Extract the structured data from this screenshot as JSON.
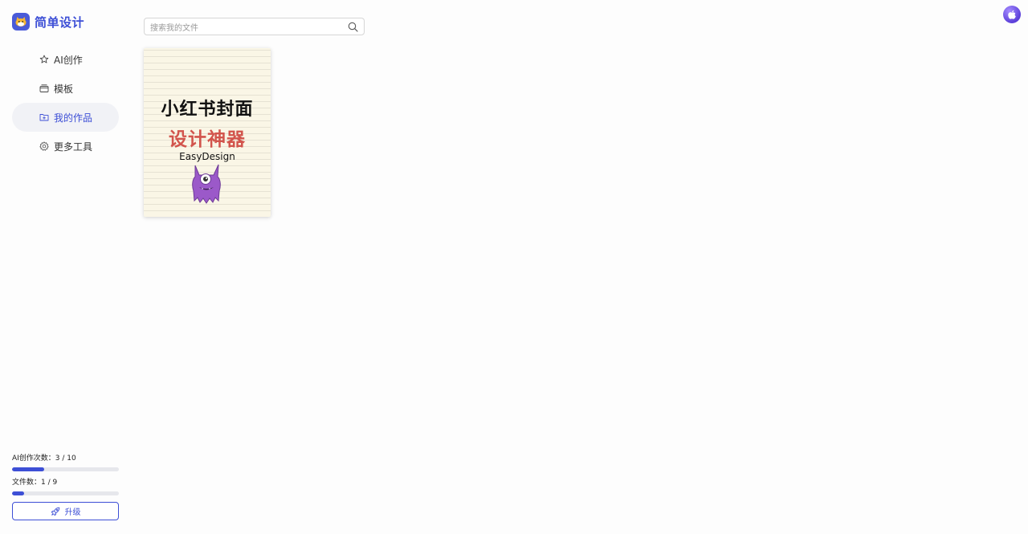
{
  "app": {
    "name": "简单设计"
  },
  "nav": [
    {
      "label": "AI创作",
      "icon": "star-icon"
    },
    {
      "label": "模板",
      "icon": "template-icon"
    },
    {
      "label": "我的作品",
      "icon": "folder-icon",
      "active": true
    },
    {
      "label": "更多工具",
      "icon": "gear-icon"
    }
  ],
  "quota": {
    "ai_label": "AI创作次数：3 / 10",
    "ai_used": 3,
    "ai_total": 10,
    "files_label": "文件数：1 / 9",
    "files_used": 1,
    "files_total": 9,
    "upgrade_label": "升级"
  },
  "search": {
    "placeholder": "搜索我的文件",
    "value": ""
  },
  "files": [
    {
      "title_line1": "小红书封面",
      "title_line2": "设计神器",
      "brand": "EasyDesign"
    }
  ],
  "colors": {
    "accent": "#3d4fd6",
    "active_bg": "#f1f2f6",
    "cover_bg": "#faf6e6",
    "cover_red": "#d2544c"
  }
}
